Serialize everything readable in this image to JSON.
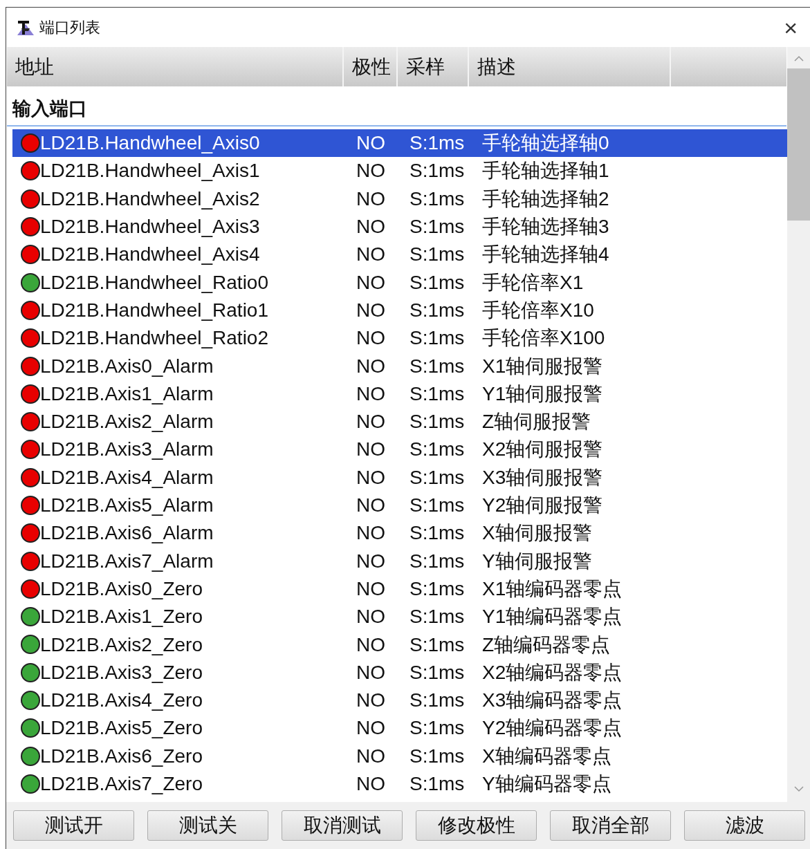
{
  "window": {
    "title": "端口列表",
    "close": "×"
  },
  "table": {
    "columns": [
      "地址",
      "极性",
      "采样",
      "描述"
    ],
    "group": "输入端口",
    "rows": [
      {
        "address": "LD21B.Handwheel_Axis0",
        "polarity": "NO",
        "sampling": "S:1ms",
        "description": "手轮轴选择轴0",
        "color": "#e80000",
        "selected": true
      },
      {
        "address": "LD21B.Handwheel_Axis1",
        "polarity": "NO",
        "sampling": "S:1ms",
        "description": "手轮轴选择轴1",
        "color": "#e80000",
        "selected": false
      },
      {
        "address": "LD21B.Handwheel_Axis2",
        "polarity": "NO",
        "sampling": "S:1ms",
        "description": "手轮轴选择轴2",
        "color": "#e80000",
        "selected": false
      },
      {
        "address": "LD21B.Handwheel_Axis3",
        "polarity": "NO",
        "sampling": "S:1ms",
        "description": "手轮轴选择轴3",
        "color": "#e80000",
        "selected": false
      },
      {
        "address": "LD21B.Handwheel_Axis4",
        "polarity": "NO",
        "sampling": "S:1ms",
        "description": "手轮轴选择轴4",
        "color": "#e80000",
        "selected": false
      },
      {
        "address": "LD21B.Handwheel_Ratio0",
        "polarity": "NO",
        "sampling": "S:1ms",
        "description": "手轮倍率X1",
        "color": "#3aa63a",
        "selected": false
      },
      {
        "address": "LD21B.Handwheel_Ratio1",
        "polarity": "NO",
        "sampling": "S:1ms",
        "description": "手轮倍率X10",
        "color": "#e80000",
        "selected": false
      },
      {
        "address": "LD21B.Handwheel_Ratio2",
        "polarity": "NO",
        "sampling": "S:1ms",
        "description": "手轮倍率X100",
        "color": "#e80000",
        "selected": false
      },
      {
        "address": "LD21B.Axis0_Alarm",
        "polarity": "NO",
        "sampling": "S:1ms",
        "description": "X1轴伺服报警",
        "color": "#e80000",
        "selected": false
      },
      {
        "address": "LD21B.Axis1_Alarm",
        "polarity": "NO",
        "sampling": "S:1ms",
        "description": "Y1轴伺服报警",
        "color": "#e80000",
        "selected": false
      },
      {
        "address": "LD21B.Axis2_Alarm",
        "polarity": "NO",
        "sampling": "S:1ms",
        "description": "Z轴伺服报警",
        "color": "#e80000",
        "selected": false
      },
      {
        "address": "LD21B.Axis3_Alarm",
        "polarity": "NO",
        "sampling": "S:1ms",
        "description": "X2轴伺服报警",
        "color": "#e80000",
        "selected": false
      },
      {
        "address": "LD21B.Axis4_Alarm",
        "polarity": "NO",
        "sampling": "S:1ms",
        "description": "X3轴伺服报警",
        "color": "#e80000",
        "selected": false
      },
      {
        "address": "LD21B.Axis5_Alarm",
        "polarity": "NO",
        "sampling": "S:1ms",
        "description": "Y2轴伺服报警",
        "color": "#e80000",
        "selected": false
      },
      {
        "address": "LD21B.Axis6_Alarm",
        "polarity": "NO",
        "sampling": "S:1ms",
        "description": "X轴伺服报警",
        "color": "#e80000",
        "selected": false
      },
      {
        "address": "LD21B.Axis7_Alarm",
        "polarity": "NO",
        "sampling": "S:1ms",
        "description": "Y轴伺服报警",
        "color": "#e80000",
        "selected": false
      },
      {
        "address": "LD21B.Axis0_Zero",
        "polarity": "NO",
        "sampling": "S:1ms",
        "description": "X1轴编码器零点",
        "color": "#e80000",
        "selected": false
      },
      {
        "address": "LD21B.Axis1_Zero",
        "polarity": "NO",
        "sampling": "S:1ms",
        "description": "Y1轴编码器零点",
        "color": "#3aa63a",
        "selected": false
      },
      {
        "address": "LD21B.Axis2_Zero",
        "polarity": "NO",
        "sampling": "S:1ms",
        "description": "Z轴编码器零点",
        "color": "#3aa63a",
        "selected": false
      },
      {
        "address": "LD21B.Axis3_Zero",
        "polarity": "NO",
        "sampling": "S:1ms",
        "description": "X2轴编码器零点",
        "color": "#3aa63a",
        "selected": false
      },
      {
        "address": "LD21B.Axis4_Zero",
        "polarity": "NO",
        "sampling": "S:1ms",
        "description": "X3轴编码器零点",
        "color": "#3aa63a",
        "selected": false
      },
      {
        "address": "LD21B.Axis5_Zero",
        "polarity": "NO",
        "sampling": "S:1ms",
        "description": "Y2轴编码器零点",
        "color": "#3aa63a",
        "selected": false
      },
      {
        "address": "LD21B.Axis6_Zero",
        "polarity": "NO",
        "sampling": "S:1ms",
        "description": "X轴编码器零点",
        "color": "#3aa63a",
        "selected": false
      },
      {
        "address": "LD21B.Axis7_Zero",
        "polarity": "NO",
        "sampling": "S:1ms",
        "description": "Y轴编码器零点",
        "color": "#3aa63a",
        "selected": false
      }
    ]
  },
  "buttons": [
    "测试开",
    "测试关",
    "取消测试",
    "修改极性",
    "取消全部",
    "滤波"
  ]
}
